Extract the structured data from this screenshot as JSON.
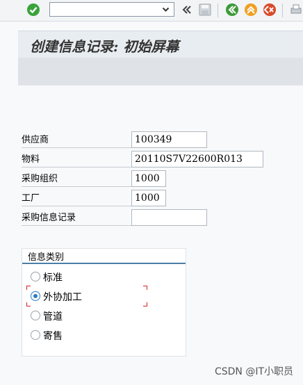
{
  "toolbar": {
    "command_field": {
      "value": "",
      "placeholder": ""
    },
    "icons": [
      "enter-icon",
      "back-arrows-icon",
      "save-icon",
      "back-icon",
      "exit-icon",
      "cancel-icon",
      "print-icon"
    ]
  },
  "title": "创建信息记录: 初始屏幕",
  "form": {
    "fields": [
      {
        "label": "供应商",
        "value": "100349"
      },
      {
        "label": "物料",
        "value": "20110S7V22600R013"
      },
      {
        "label": "采购组织",
        "value": "1000"
      },
      {
        "label": "工厂",
        "value": "1000"
      },
      {
        "label": "采购信息记录",
        "value": ""
      }
    ]
  },
  "info_category": {
    "title": "信息类别",
    "options": [
      {
        "label": "标准",
        "selected": false
      },
      {
        "label": "外协加工",
        "selected": true
      },
      {
        "label": "管道",
        "selected": false
      },
      {
        "label": "寄售",
        "selected": false
      }
    ]
  },
  "watermark": "CSDN @IT小职员",
  "colors": {
    "accent": "#2d7dc4",
    "enter_green": "#3ca33c",
    "nav_green": "#3f9a3a",
    "orange": "#f0a020",
    "cancel_red": "#d94a2a"
  }
}
